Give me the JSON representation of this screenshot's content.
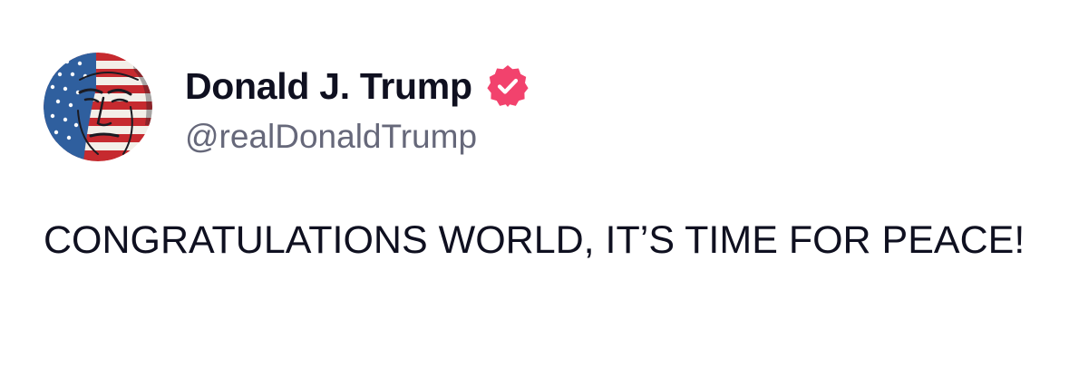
{
  "author": {
    "display_name": "Donald J. Trump",
    "handle": "@realDonaldTrump",
    "verified": true,
    "avatar_icon": "flag-face-avatar"
  },
  "post": {
    "text": "CONGRATULATIONS WORLD, IT’S TIME FOR PEACE!"
  },
  "colors": {
    "text": "#0f1020",
    "handle": "#66687a",
    "verified_badge": "#f2426d",
    "flag_red": "#c62a2f",
    "flag_blue": "#2f5f9e"
  }
}
